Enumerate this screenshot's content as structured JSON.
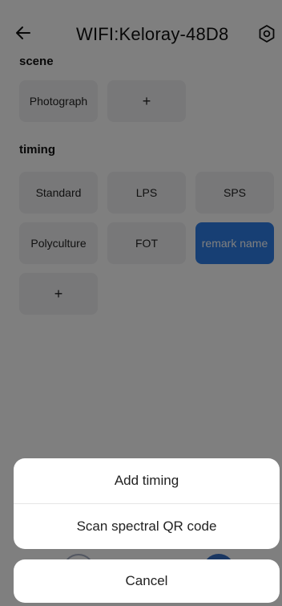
{
  "header": {
    "title": "WIFI:Keloray-48D8",
    "back_icon": "arrow-left-icon",
    "settings_icon": "settings-icon"
  },
  "scene": {
    "label": "scene",
    "items": [
      "Photograph"
    ],
    "add_label": "+"
  },
  "timing": {
    "label": "timing",
    "items": [
      "Standard",
      "LPS",
      "SPS",
      "Polyculture",
      "FOT",
      "remark name"
    ],
    "selected": "remark name",
    "add_label": "+"
  },
  "action_sheet": {
    "items": [
      "Add timing",
      "Scan spectral QR code"
    ],
    "cancel_label": "Cancel"
  },
  "colors": {
    "accent": "#2f7fe8",
    "chip_bg": "#f1f1f3",
    "overlay": "rgba(0,0,0,0.5)"
  }
}
